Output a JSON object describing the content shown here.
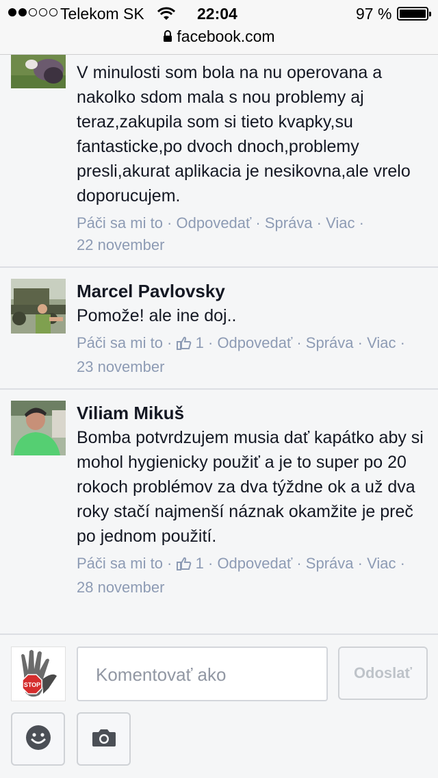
{
  "status": {
    "carrier": "Telekom SK",
    "time": "22:04",
    "battery": "97 %",
    "url": "facebook.com"
  },
  "comments": [
    {
      "name": "",
      "text": "V minulosti som bola na nu operovana a nakolko sdom mala s nou problemy aj teraz,zakupila som si tieto kvapky,su fantasticke,po dvoch dnoch,problemy presli,akurat aplikacia je nesikovna,ale vrelo doporucujem.",
      "like": "Páči sa mi to",
      "likes": "",
      "reply": "Odpovedať",
      "message": "Správa",
      "more": "Viac",
      "date": "22 november"
    },
    {
      "name": "Marcel Pavlovsky",
      "text": "Pomože! ale ine doj..",
      "like": "Páči sa mi to",
      "likes": "1",
      "reply": "Odpovedať",
      "message": "Správa",
      "more": "Viac",
      "date": "23 november"
    },
    {
      "name": "Viliam Mikuš",
      "text": "Bomba potvrdzujem musia dať kapátko aby si mohol hygienicky použiť a je to super po 20 rokoch problémov za dva týždne ok a už dva roky stačí najmenší náznak okamžite je preč po jednom použití.",
      "like": "Páči sa mi to",
      "likes": "1",
      "reply": "Odpovedať",
      "message": "Správa",
      "more": "Viac",
      "date": "28 november"
    }
  ],
  "composer": {
    "placeholder": "Komentovať ako",
    "send": "Odoslať",
    "stop_sign": "STOP"
  },
  "icons": {
    "lock": "lock-icon",
    "wifi": "wifi-icon",
    "thumb": "thumbs-up-icon",
    "smiley": "smiley-icon",
    "camera": "camera-icon"
  },
  "colors": {
    "meta": "#8d9bb4",
    "text": "#141823",
    "background": "#f5f6f7"
  }
}
